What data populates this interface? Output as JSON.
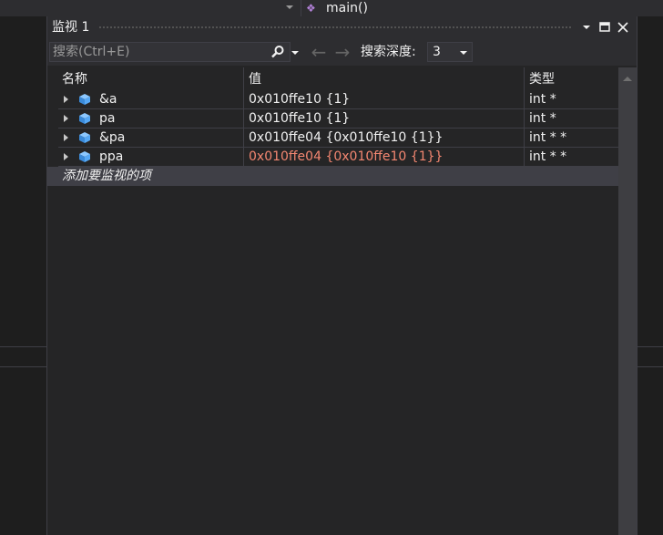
{
  "background": {
    "editor_function": "main()"
  },
  "watch": {
    "title": "监视 1",
    "search": {
      "placeholder": "搜索(Ctrl+E)"
    },
    "nav": {
      "back": "←",
      "forward": "→"
    },
    "depth": {
      "label": "搜索深度:",
      "value": "3"
    },
    "columns": [
      "名称",
      "值",
      "类型"
    ],
    "rows": [
      {
        "name": "&a",
        "value": "0x010ffe10 {1}",
        "type": "int *",
        "changed": false
      },
      {
        "name": "pa",
        "value": "0x010ffe10 {1}",
        "type": "int *",
        "changed": false
      },
      {
        "name": "&pa",
        "value": "0x010ffe04 {0x010ffe10 {1}}",
        "type": "int * *",
        "changed": false
      },
      {
        "name": "ppa",
        "value": "0x010ffe04 {0x010ffe10 {1}}",
        "type": "int * *",
        "changed": true
      }
    ],
    "add_item": "添加要监视的项"
  },
  "colors": {
    "changed_value": "#f48771",
    "normal_text": "#f1f1f1",
    "cube_icon": "#56a8f5"
  }
}
